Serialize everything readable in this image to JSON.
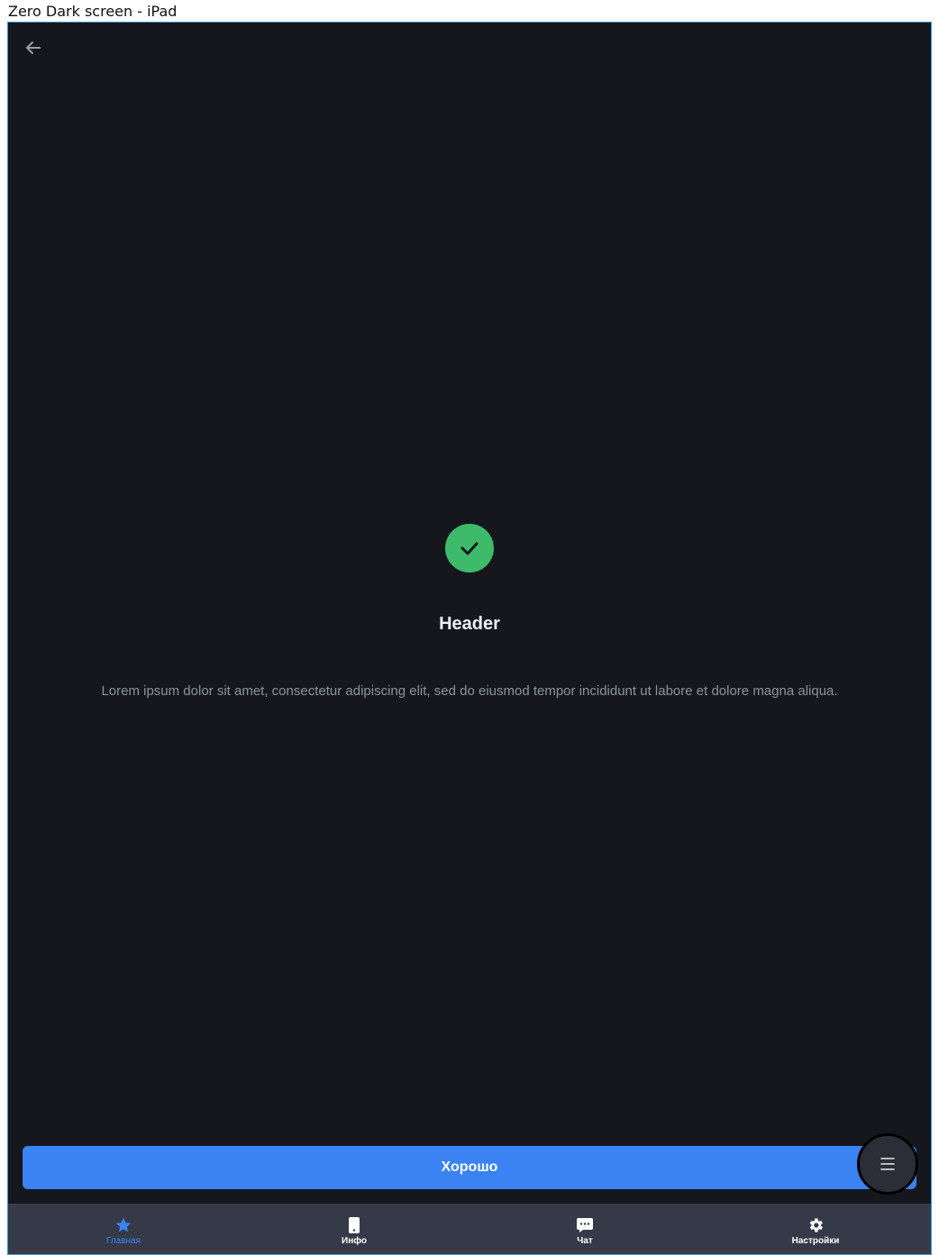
{
  "window": {
    "title": "Zero Dark screen - iPad"
  },
  "screen": {
    "header": "Header",
    "description": "Lorem ipsum dolor sit amet, consectetur adipiscing elit, sed do eiusmod tempor incididunt ut labore et dolore magna aliqua.",
    "primary_button_label": "Хорошо"
  },
  "tabbar": {
    "items": [
      {
        "label": "Главная",
        "icon": "star-icon",
        "active": true
      },
      {
        "label": "Инфо",
        "icon": "phone-icon",
        "active": false
      },
      {
        "label": "Чат",
        "icon": "chat-icon",
        "active": false
      },
      {
        "label": "Настройки",
        "icon": "gear-icon",
        "active": false
      }
    ]
  },
  "colors": {
    "background": "#15171d",
    "accent": "#3b82f2",
    "success": "#3dbb6a",
    "tabbar": "#363947"
  }
}
